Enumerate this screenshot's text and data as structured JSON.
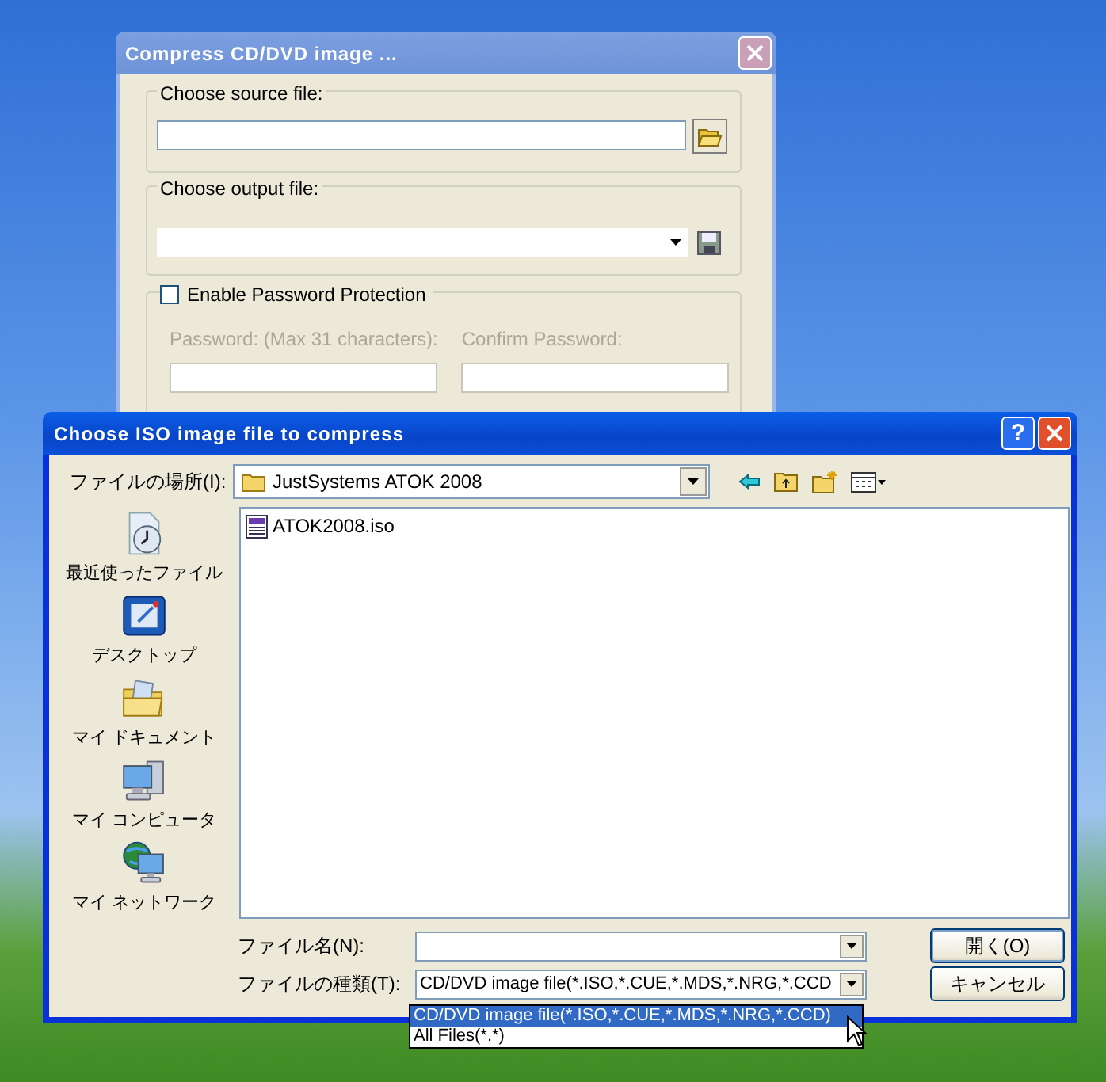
{
  "compress_window": {
    "title": "Compress CD/DVD image ...",
    "source_group": {
      "label": "Choose source file:"
    },
    "output_group": {
      "label": "Choose output file:"
    },
    "password_group": {
      "label": "Enable Password Protection",
      "checked": false,
      "fields": [
        {
          "label": "Password: (Max 31 characters):"
        },
        {
          "label": "Confirm Password:"
        }
      ]
    }
  },
  "open_dialog": {
    "title": "Choose ISO image file to compress",
    "help": "?",
    "look_in": {
      "label": "ファイルの場所(I):",
      "value": "JustSystems ATOK 2008"
    },
    "places": [
      {
        "label": "最近使ったファイル"
      },
      {
        "label": "デスクトップ"
      },
      {
        "label": "マイ ドキュメント"
      },
      {
        "label": "マイ コンピュータ"
      },
      {
        "label": "マイ ネットワーク"
      }
    ],
    "files": [
      {
        "name": "ATOK2008.iso",
        "selected": false
      }
    ],
    "file_name": {
      "label": "ファイル名(N):"
    },
    "file_type": {
      "label": "ファイルの種類(T):",
      "value": "CD/DVD image file(*.ISO,*.CUE,*.MDS,*.NRG,*.CCD"
    },
    "buttons": [
      "開く(O)",
      "キャンセル"
    ],
    "type_options": [
      {
        "label": "CD/DVD image file(*.ISO,*.CUE,*.MDS,*.NRG,*.CCD)",
        "selected": true
      },
      {
        "label": "All Files(*.*)",
        "selected": false
      }
    ]
  }
}
